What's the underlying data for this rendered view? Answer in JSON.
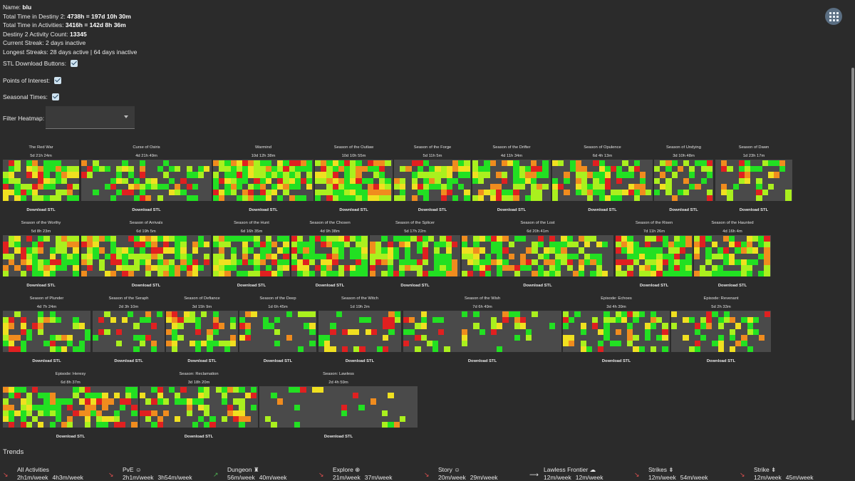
{
  "profile": {
    "name_label": "Name:",
    "name_value": "blu",
    "total_time_label": "Total Time in Destiny 2:",
    "total_time_value": "4738h = 197d 10h 30m",
    "activity_time_label": "Total Time in Activities:",
    "activity_time_value": "3416h = 142d 8h 36m",
    "activity_count_label": "Destiny 2 Activity Count:",
    "activity_count_value": "13345",
    "current_streak_label": "Current Streak:",
    "current_streak_value": "2 days inactive",
    "longest_streaks_label": "Longest Streaks:",
    "longest_streaks_value": "28 days active | 64 days inactive"
  },
  "options": {
    "stl_label": "STL Download Buttons:",
    "stl_checked": true,
    "poi_label": "Points of Interest:",
    "poi_checked": true,
    "seasonal_label": "Seasonal Times:",
    "seasonal_checked": true,
    "filter_label": "Filter Heatmap:",
    "filter_value": ""
  },
  "download_label": "Download STL",
  "colors": {
    "green": "#22e022",
    "lime": "#aaf01e",
    "yellow": "#f0e020",
    "orange": "#f08c1e",
    "red": "#e02020",
    "empty": "#4a4a4a",
    "background": "#2b2b2b"
  },
  "seasons": [
    {
      "title": "The Red War",
      "time": "5d 21h 24m",
      "density": 0.72
    },
    {
      "title": "Curse of Osiris",
      "time": "4d 21h 49m",
      "density": 0.45
    },
    {
      "title": "Warmind",
      "time": "10d 12h 38m",
      "density": 0.8
    },
    {
      "title": "Season of the Outlaw",
      "time": "10d 10h 55m",
      "density": 0.85
    },
    {
      "title": "Season of the Forge",
      "time": "5d 11h 5m",
      "density": 0.65
    },
    {
      "title": "Season of the Drifter",
      "time": "4d 11h 34m",
      "density": 0.7
    },
    {
      "title": "Season of Opulence",
      "time": "6d 4h 13m",
      "density": 0.55
    },
    {
      "title": "Season of Undying",
      "time": "3d 10h 48m",
      "density": 0.45
    },
    {
      "title": "Season of Dawn",
      "time": "1d 23h 17m",
      "density": 0.4
    },
    {
      "title": "Season of the Worthy",
      "time": "5d 8h 23m",
      "density": 0.72
    },
    {
      "title": "Season of Arrivals",
      "time": "6d 19h 5m",
      "density": 0.68
    },
    {
      "title": "Season of the Hunt",
      "time": "6d 16h 35m",
      "density": 0.75
    },
    {
      "title": "Season of the Chosen",
      "time": "4d 9h 38m",
      "density": 0.82
    },
    {
      "title": "Season of the Splicer",
      "time": "5d 17h 22m",
      "density": 0.72
    },
    {
      "title": "Season of the Lost",
      "time": "6d 20h 41m",
      "density": 0.68
    },
    {
      "title": "Season of the Risen",
      "time": "7d 11h 26m",
      "density": 0.8
    },
    {
      "title": "Season of the Haunted",
      "time": "4d 16h 4m",
      "density": 0.72
    },
    {
      "title": "Season of Plunder",
      "time": "4d 7h 24m",
      "density": 0.5
    },
    {
      "title": "Season of the Seraph",
      "time": "2d 3h 10m",
      "density": 0.4
    },
    {
      "title": "Season of Defiance",
      "time": "3d 15h 9m",
      "density": 0.45
    },
    {
      "title": "Season of the Deep",
      "time": "1d 6h 45m",
      "density": 0.3
    },
    {
      "title": "Season of the Witch",
      "time": "1d 19h 2m",
      "density": 0.35
    },
    {
      "title": "Season of the Wish",
      "time": "7d 6h 49m",
      "density": 0.3
    },
    {
      "title": "Episode: Echoes",
      "time": "3d 4h 39m",
      "density": 0.5
    },
    {
      "title": "Episode: Revenant",
      "time": "5d 2h 33m",
      "density": 0.35
    },
    {
      "title": "Episode: Heresy",
      "time": "6d 8h 37m",
      "density": 0.58
    },
    {
      "title": "Season: Reclamation",
      "time": "3d 18h 20m",
      "density": 0.5
    },
    {
      "title": "Season: Lawless",
      "time": "2d 4h 59m",
      "density": 0.12
    }
  ],
  "trends": {
    "title": "Trends",
    "items": [
      {
        "name": "All Activities",
        "dir": "down",
        "v1": "2h1m/week",
        "v2": "4h3m/week"
      },
      {
        "name": "PvE ☺",
        "dir": "down",
        "v1": "2h1m/week",
        "v2": "3h54m/week"
      },
      {
        "name": "Dungeon ♜",
        "dir": "up",
        "v1": "56m/week",
        "v2": "40m/week"
      },
      {
        "name": "Explore ⊕",
        "dir": "down",
        "v1": "21m/week",
        "v2": "37m/week"
      },
      {
        "name": "Story ☺",
        "dir": "down",
        "v1": "20m/week",
        "v2": "29m/week"
      },
      {
        "name": "Lawless Frontier ☁",
        "dir": "flat",
        "v1": "12m/week",
        "v2": "12m/week"
      },
      {
        "name": "Strikes ⇟",
        "dir": "down",
        "v1": "12m/week",
        "v2": "54m/week"
      },
      {
        "name": "Strike ⇟",
        "dir": "down",
        "v1": "12m/week",
        "v2": "45m/week"
      }
    ]
  }
}
